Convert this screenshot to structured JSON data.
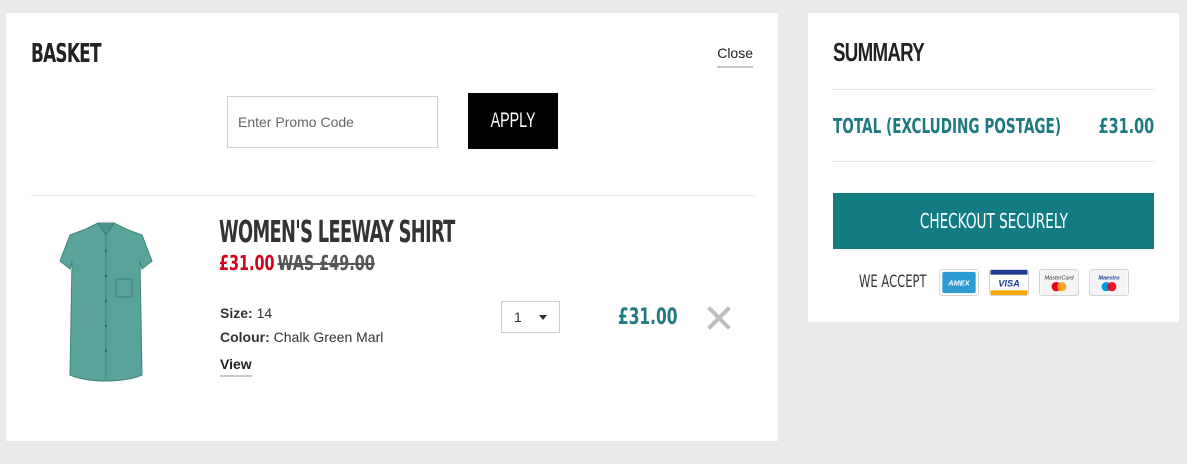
{
  "basket": {
    "title": "BASKET",
    "close_label": "Close",
    "promo": {
      "placeholder": "Enter Promo Code",
      "value": "",
      "apply_label": "APPLY"
    },
    "items": [
      {
        "name": "WOMEN'S LEEWAY SHIRT",
        "sale_price": "£31.00",
        "was_price": "WAS £49.00",
        "size_label": "Size:",
        "size_value": "14",
        "colour_label": "Colour:",
        "colour_value": "Chalk Green Marl",
        "view_label": "View",
        "quantity": "1",
        "line_total": "£31.00",
        "image_icon": "shirt-image"
      }
    ]
  },
  "summary": {
    "title": "SUMMARY",
    "total_label": "TOTAL (EXCLUDING POSTAGE)",
    "total_value": "£31.00",
    "checkout_label": "CHECKOUT SECURELY",
    "we_accept_label": "WE ACCEPT",
    "cards": [
      {
        "name": "amex-icon",
        "label": "AMEX"
      },
      {
        "name": "visa-icon",
        "label": "VISA"
      },
      {
        "name": "mastercard-icon",
        "label": "MasterCard"
      },
      {
        "name": "maestro-icon",
        "label": "Maestro"
      }
    ]
  },
  "colors": {
    "accent": "#127c82",
    "accent_text": "#1e7a80",
    "sale": "#d0021b",
    "background": "#ebebeb"
  }
}
